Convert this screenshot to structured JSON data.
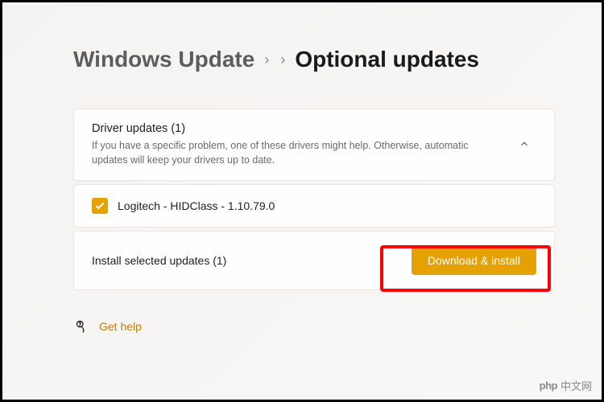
{
  "breadcrumb": {
    "parent": "Windows Update",
    "current": "Optional updates"
  },
  "driver_section": {
    "title": "Driver updates (1)",
    "description": "If you have a specific problem, one of these drivers might help. Otherwise, automatic updates will keep your drivers up to date."
  },
  "driver_item": {
    "label": "Logitech - HIDClass - 1.10.79.0",
    "checked": true
  },
  "install": {
    "label": "Install selected updates (1)",
    "button": "Download & install"
  },
  "help": {
    "label": "Get help"
  },
  "watermark": {
    "logo": "php",
    "text": "中文网"
  },
  "colors": {
    "accent": "#e5a100",
    "highlight": "#ff0000"
  }
}
